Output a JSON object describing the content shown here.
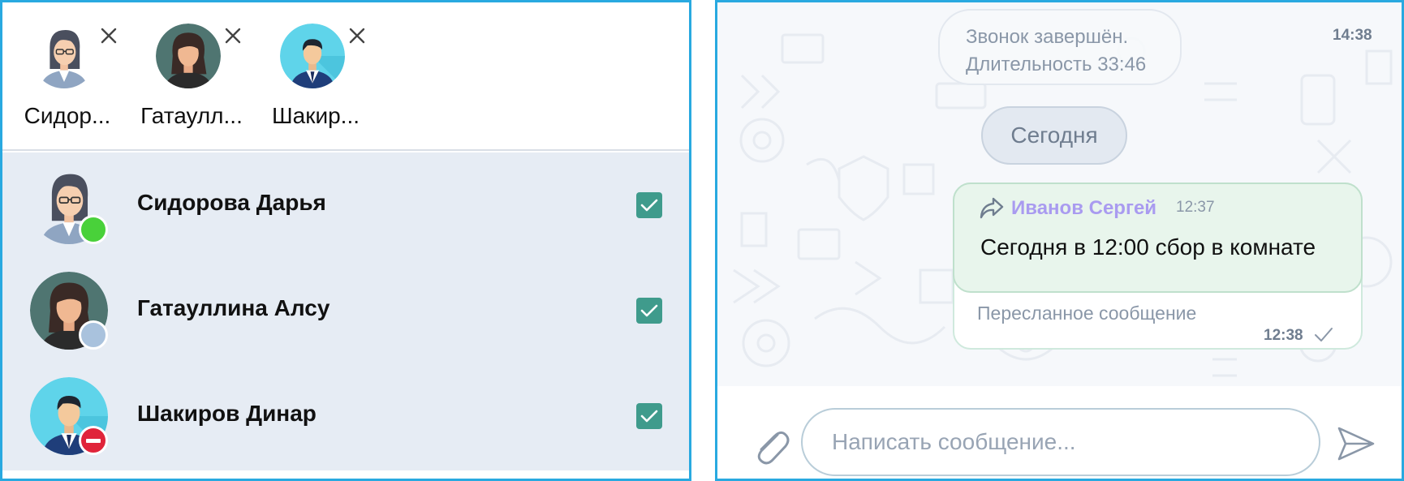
{
  "colors": {
    "panel_border": "#29a9e0",
    "selected_rows_bg": "#e6ecf4",
    "checkbox": "#3f9b8c",
    "status_online": "#49d13a",
    "status_away": "#a9c2dd",
    "status_dnd": "#e0243a",
    "sender_name": "#a99bf0",
    "message_bubble": "#e8f5ec"
  },
  "selected_chips": [
    {
      "name": "Сидор...",
      "avatar": "woman-glasses-avatar",
      "close_icon": "close-icon"
    },
    {
      "name": "Гатаулл...",
      "avatar": "woman-dark-hair-avatar",
      "close_icon": "close-icon"
    },
    {
      "name": "Шакир...",
      "avatar": "man-suit-avatar",
      "close_icon": "close-icon"
    }
  ],
  "contacts": [
    {
      "name": "Сидорова Дарья",
      "avatar": "woman-glasses-avatar",
      "status": "online",
      "checked": true
    },
    {
      "name": "Гатауллина Алсу",
      "avatar": "woman-dark-hair-avatar",
      "status": "away",
      "checked": true
    },
    {
      "name": "Шакиров Динар",
      "avatar": "man-suit-avatar",
      "status": "do-not-disturb",
      "checked": true
    }
  ],
  "chat": {
    "call_ended": {
      "line1": "Звонок завершён.",
      "line2": "Длительность 33:46",
      "time": "14:38"
    },
    "date_separator": "Сегодня",
    "message": {
      "forward_icon": "forward-arrow-icon",
      "sender": "Иванов Сергей",
      "sent_time": "12:37",
      "text": "Сегодня в 12:00 сбор в комнате",
      "forwarded_label": "Пересланное сообщение",
      "delivered_time": "12:38",
      "read_icon": "checkmark-icon"
    },
    "composer": {
      "placeholder": "Написать сообщение...",
      "attach_icon": "paperclip-icon",
      "send_icon": "send-icon"
    }
  }
}
